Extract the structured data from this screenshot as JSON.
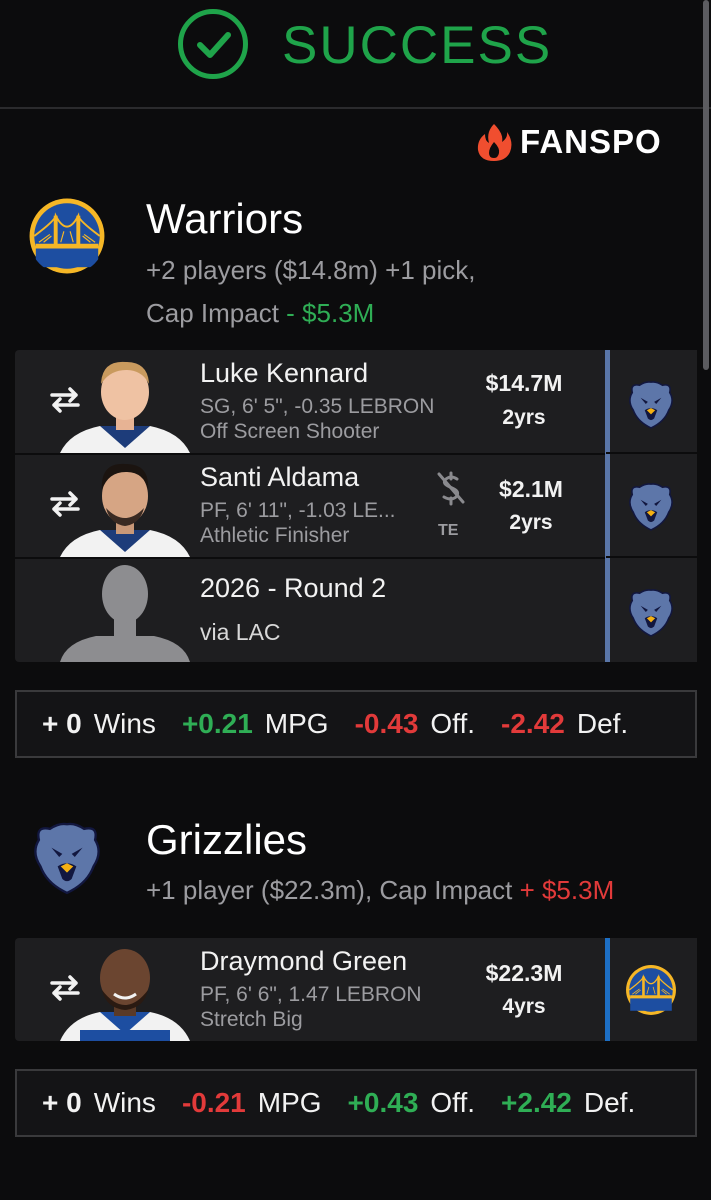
{
  "header": {
    "status_text": "SUCCESS",
    "status_color": "#1fa44a",
    "brand": "FANSPO"
  },
  "warriors": {
    "name": "Warriors",
    "summary_line1": "+2 players ($14.8m) +1 pick,",
    "cap_label": "Cap Impact ",
    "cap_value": "- $5.3M",
    "logo_icon": "warriors-logo",
    "incoming": [
      {
        "name": "Luke Kennard",
        "details": "SG, 6' 5\", -0.35 LEBRON",
        "role": "Off Screen Shooter",
        "salary": "$14.7M",
        "years": "2yrs",
        "from_icon": "grizzlies-logo"
      },
      {
        "name": "Santi Aldama",
        "details": "PF, 6' 11\", -1.03 LE...",
        "role": "Athletic Finisher",
        "salary": "$2.1M",
        "years": "2yrs",
        "exception": "TE",
        "from_icon": "grizzlies-logo"
      },
      {
        "name": "2026 - Round 2",
        "details": "via LAC",
        "from_icon": "grizzlies-logo"
      }
    ],
    "stats": {
      "wins_val": "+ 0",
      "wins_lbl": "Wins",
      "mpg_val": "+0.21",
      "mpg_lbl": "MPG",
      "off_val": "-0.43",
      "off_lbl": "Off.",
      "def_val": "-2.42",
      "def_lbl": "Def."
    }
  },
  "grizzlies": {
    "name": "Grizzlies",
    "summary_line1": "+1 player ($22.3m), Cap Impact ",
    "cap_value": "+ $5.3M",
    "logo_icon": "grizzlies-logo",
    "incoming": [
      {
        "name": "Draymond Green",
        "details": "PF, 6' 6\", 1.47 LEBRON",
        "role": "Stretch Big",
        "salary": "$22.3M",
        "years": "4yrs",
        "from_icon": "warriors-logo"
      }
    ],
    "stats": {
      "wins_val": "+ 0",
      "wins_lbl": "Wins",
      "mpg_val": "-0.21",
      "mpg_lbl": "MPG",
      "off_val": "+0.43",
      "off_lbl": "Off.",
      "def_val": "+2.42",
      "def_lbl": "Def."
    }
  },
  "colors": {
    "positive": "#2fae55",
    "negative": "#e23a3a",
    "grizzlies_bar": "#5a76a8",
    "warriors_bar": "#1d6fc4"
  }
}
